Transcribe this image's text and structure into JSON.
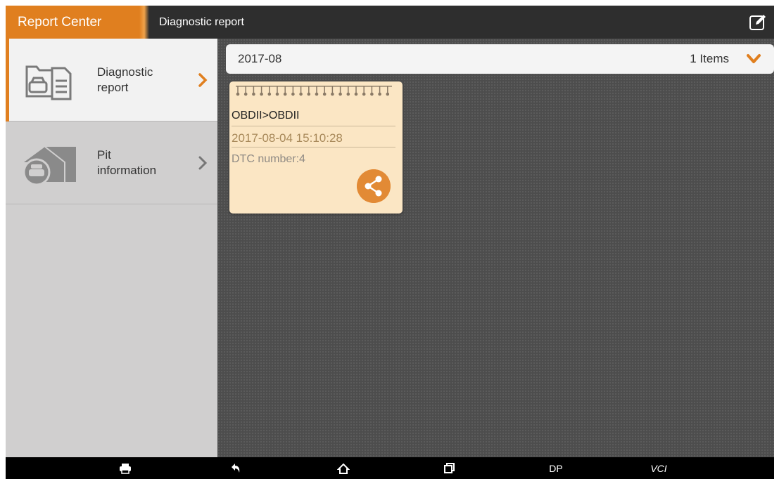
{
  "header": {
    "app_title": "Report Center",
    "subtitle": "Diagnostic report",
    "edit_icon": "edit-icon"
  },
  "sidebar": {
    "items": [
      {
        "label_line1": "Diagnostic",
        "label_line2": "report",
        "icon": "car-document-icon",
        "active": true
      },
      {
        "label_line1": "Pit",
        "label_line2": "information",
        "icon": "garage-icon",
        "active": false
      }
    ]
  },
  "main": {
    "month_group": {
      "month": "2017-08",
      "count_label": "1 Items",
      "toggle_icon": "chevron-down-icon"
    },
    "reports": [
      {
        "title": "OBDII>OBDII",
        "datetime": "2017-08-04 15:10:28",
        "dtc": "DTC number:4",
        "share_icon": "share-icon"
      }
    ]
  },
  "navbar": {
    "dp_label": "DP",
    "vci_label": "VCI"
  },
  "colors": {
    "accent": "#e07f1f",
    "card_bg": "#fbe6c4",
    "share_button": "#e28a35"
  }
}
